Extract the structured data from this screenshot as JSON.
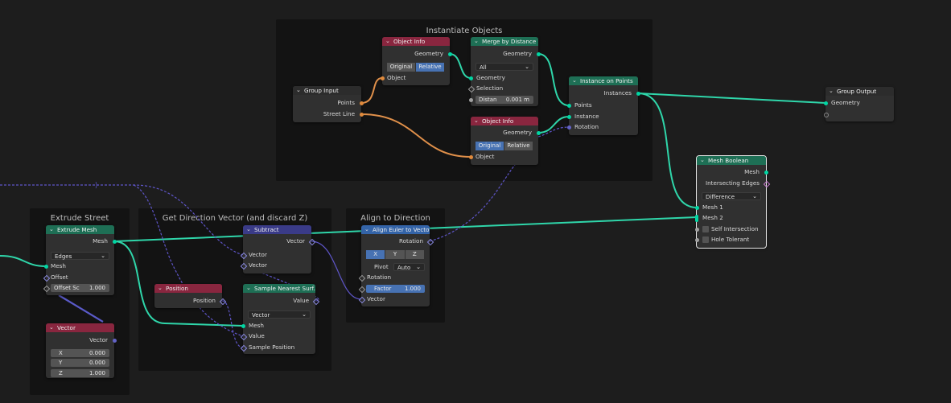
{
  "frames": {
    "instantiate": "Instantiate Objects",
    "extrude": "Extrude Street",
    "direction": "Get Direction Vector (and discard Z)",
    "align": "Align to Direction"
  },
  "nodes": {
    "group_input": {
      "title": "Group Input",
      "points": "Points",
      "street_line": "Street Line"
    },
    "object_info_1": {
      "title": "Object Info",
      "geometry": "Geometry",
      "original": "Original",
      "relative": "Relative",
      "object": "Object"
    },
    "merge": {
      "title": "Merge by Distance",
      "geometry_out": "Geometry",
      "mode": "All",
      "geometry_in": "Geometry",
      "selection": "Selection",
      "distance_label": "Distan",
      "distance_value": "0.001 m"
    },
    "object_info_2": {
      "title": "Object Info",
      "geometry": "Geometry",
      "original": "Original",
      "relative": "Relative",
      "object": "Object"
    },
    "instance_on_points": {
      "title": "Instance on Points",
      "instances": "Instances",
      "points": "Points",
      "instance": "Instance",
      "rotation": "Rotation"
    },
    "group_output": {
      "title": "Group Output",
      "geometry": "Geometry"
    },
    "mesh_boolean": {
      "title": "Mesh Boolean",
      "mesh_out": "Mesh",
      "intersecting": "Intersecting Edges",
      "mode": "Difference",
      "mesh1": "Mesh 1",
      "mesh2": "Mesh 2",
      "self_intersection": "Self Intersection",
      "hole_tolerant": "Hole Tolerant"
    },
    "extrude_mesh": {
      "title": "Extrude Mesh",
      "mesh_out": "Mesh",
      "mode": "Edges",
      "mesh_in": "Mesh",
      "offset": "Offset",
      "offset_scale_label": "Offset Sc",
      "offset_scale_value": "1.000"
    },
    "vector": {
      "title": "Vector",
      "vector": "Vector",
      "x_label": "X",
      "x": "0.000",
      "y_label": "Y",
      "y": "0.000",
      "z_label": "Z",
      "z": "1.000"
    },
    "subtract": {
      "title": "Subtract",
      "vector_out": "Vector",
      "vector_a": "Vector",
      "vector_b": "Vector"
    },
    "position": {
      "title": "Position",
      "position": "Position"
    },
    "sample_nearest": {
      "title": "Sample Nearest Surf...",
      "value_out": "Value",
      "type": "Vector",
      "mesh": "Mesh",
      "value": "Value",
      "sample_position": "Sample Position"
    },
    "align_euler": {
      "title": "Align Euler to Vector",
      "rotation_out": "Rotation",
      "x": "X",
      "y": "Y",
      "z": "Z",
      "pivot_label": "Pivot",
      "pivot": "Auto",
      "rotation_in": "Rotation",
      "factor_label": "Factor",
      "factor_value": "1.000",
      "vector": "Vector"
    }
  },
  "colors": {
    "geometry_header": "#1e6f55",
    "input_header": "#89263f",
    "vector_header": "#3a3b88",
    "converter_header": "#3464a8",
    "geometry_wire": "#2fd6aa",
    "vector_wire": "#6a5acd",
    "object_wire": "#e0904a",
    "background": "#1d1d1d",
    "frame": "#131313"
  }
}
